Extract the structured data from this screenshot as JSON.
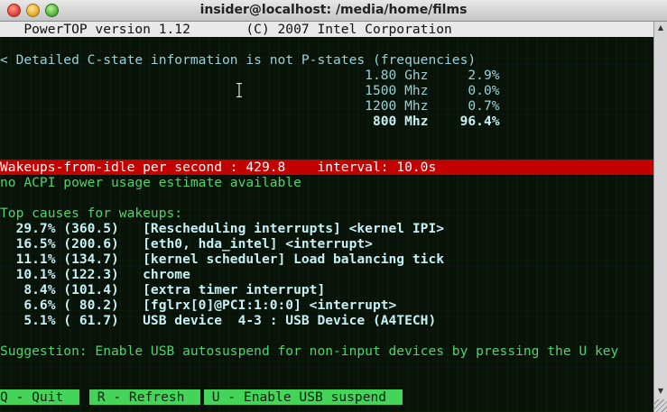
{
  "window": {
    "title": "insider@localhost: /media/home/films"
  },
  "terminal": {
    "header": "   PowerTOP version 1.12       (C) 2007 Intel Corporation",
    "cstate_note": "< Detailed C-state information is not P-states (frequencies)",
    "pstates": [
      {
        "text": "                                              1.80 Ghz     2.9%",
        "highlight": false
      },
      {
        "text": "                                              1500 Mhz     0.0%",
        "highlight": false
      },
      {
        "text": "                                              1200 Mhz     0.7%",
        "highlight": false
      },
      {
        "text": "                                               800 Mhz    96.4%",
        "highlight": true
      }
    ],
    "wakeups_bar": "Wakeups-from-idle per second : 429.8    interval: 10.0s",
    "acpi_note": "no ACPI power usage estimate available",
    "causes_heading": "Top causes for wakeups:",
    "causes": [
      "  29.7% (360.5)   [Rescheduling interrupts] <kernel IPI>",
      "  16.5% (200.6)   [eth0, hda_intel] <interrupt>",
      "  11.1% (134.7)   [kernel scheduler] Load balancing tick",
      "  10.1% (122.3)   chrome",
      "   8.4% (101.4)   [extra timer interrupt]",
      "   6.6% ( 80.2)   [fglrx[0]@PCI:1:0:0] <interrupt>",
      "   5.1% ( 61.7)   USB device  4-3 : USB Device (A4TECH)"
    ],
    "suggestion": "Suggestion: Enable USB autosuspend for non-input devices by pressing the U key",
    "footer": {
      "quit": "Q - Quit  ",
      "refresh": " R - Refresh  ",
      "usb": " U - Enable USB suspend  "
    }
  },
  "colors": {
    "terminal_text": "#4fd36b",
    "highlight_bar": "#c30000",
    "header_bg": "#e9e9e9",
    "footer_bg": "#44d45a"
  }
}
